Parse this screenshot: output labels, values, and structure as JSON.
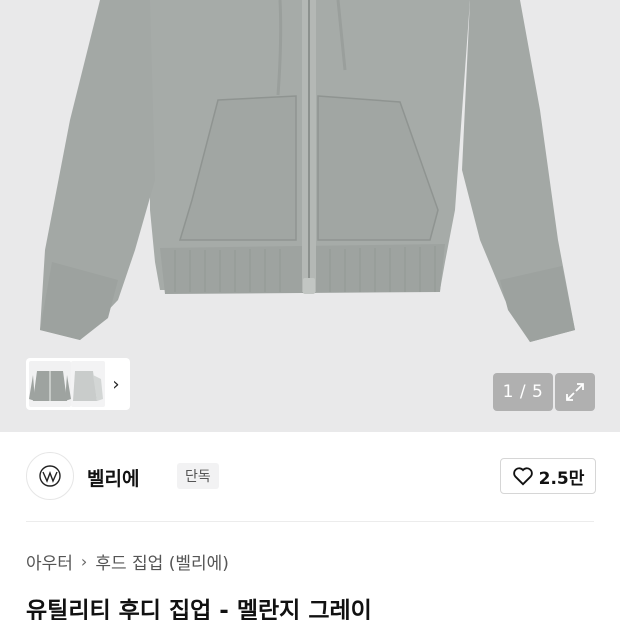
{
  "gallery": {
    "image_alt": "gray zip-up hoodie",
    "pager_current": "1",
    "pager_total": "5",
    "pager_text": "1 / 5",
    "thumb_arrow": "›",
    "expand_icon": "expand-icon"
  },
  "brand": {
    "name": "벨리에",
    "badge": "단독",
    "logo_icon": "brand-logo-icon",
    "like_count": "2.5만",
    "like_icon": "heart-icon"
  },
  "breadcrumb": {
    "items": [
      "아우터",
      "후드 집업 (벨리에)"
    ],
    "separator": "›"
  },
  "product": {
    "title": "유틸리티 후디 집업 - 멜란지 그레이"
  },
  "colors": {
    "hoodie": "#a8adaa",
    "background": "#e9e9ea"
  }
}
